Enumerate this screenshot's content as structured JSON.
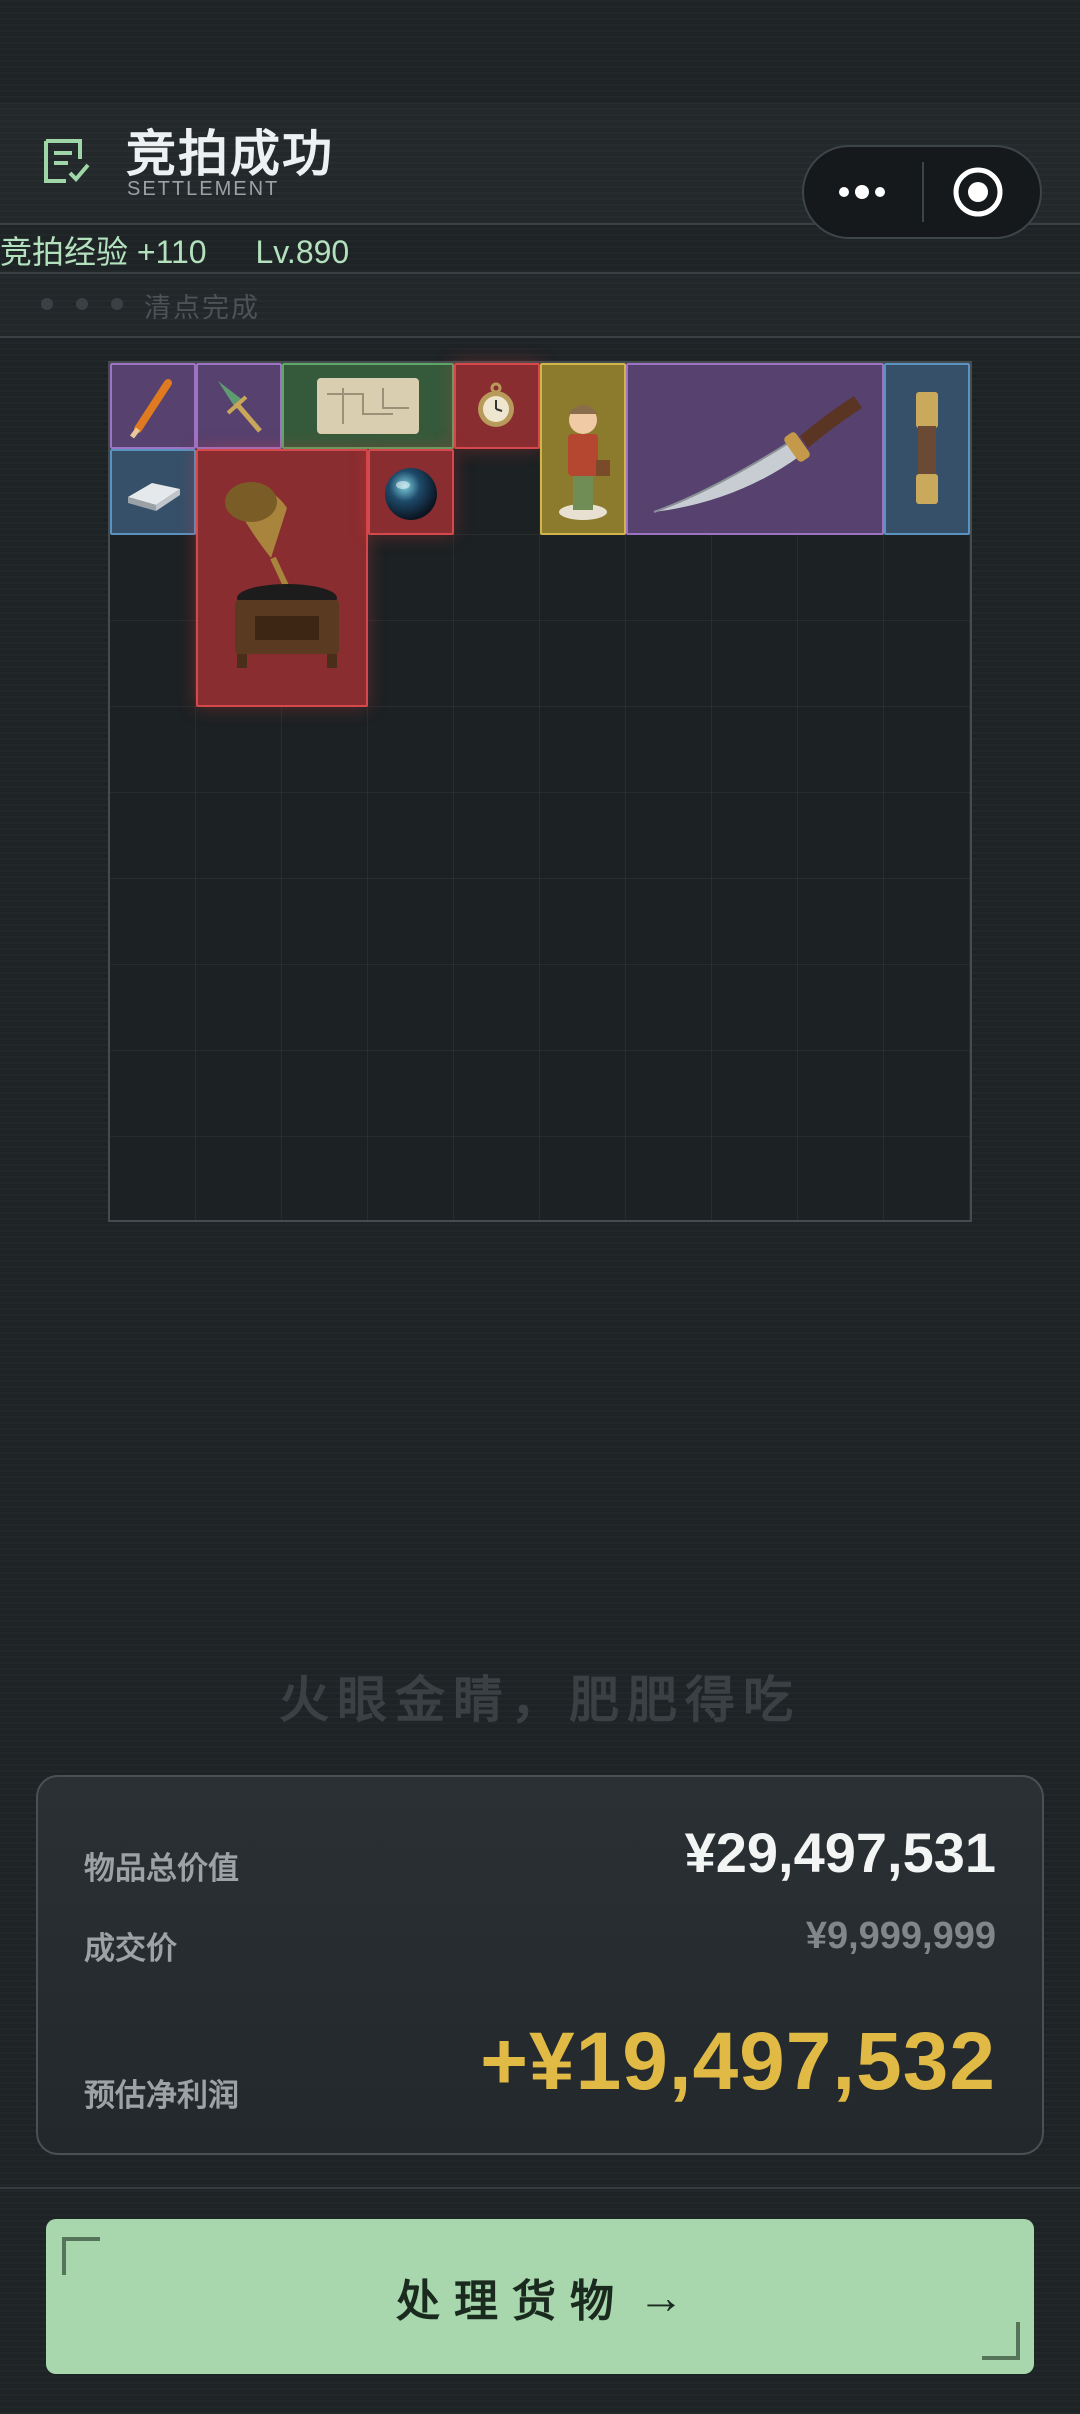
{
  "header": {
    "title": "竞拍成功",
    "subtitle": "SETTLEMENT",
    "exp_text": "竞拍经验 +110",
    "level_text": "Lv.890"
  },
  "status": {
    "text": "清点完成"
  },
  "items": [
    {
      "name": "pencil-item",
      "rarity": "purple"
    },
    {
      "name": "dagger-ornament-item",
      "rarity": "purple"
    },
    {
      "name": "old-map-item",
      "rarity": "green"
    },
    {
      "name": "pocket-watch-item",
      "rarity": "red"
    },
    {
      "name": "boy-figurine-item",
      "rarity": "gold"
    },
    {
      "name": "hunting-knife-item",
      "rarity": "purple"
    },
    {
      "name": "spyglass-item",
      "rarity": "blue"
    },
    {
      "name": "silver-ingot-item",
      "rarity": "blue"
    },
    {
      "name": "gramophone-item",
      "rarity": "red"
    },
    {
      "name": "glass-orb-item",
      "rarity": "red"
    }
  ],
  "slogan": "火眼金睛，肥肥得吃",
  "summary": {
    "total_label": "物品总价值",
    "total_value": "¥29,497,531",
    "deal_label": "成交价",
    "deal_value": "¥9,999,999",
    "profit_label": "预估净利润",
    "profit_value": "+¥19,497,532"
  },
  "cta": {
    "label": "处理货物",
    "arrow": "→"
  },
  "colors": {
    "purple": "#56416f",
    "green": "#355a3b",
    "red": "#8a2d30",
    "gold": "#8c7a2d",
    "blue": "#36506a",
    "accent": "#a8d7ad",
    "profit": "#e0ba45"
  }
}
